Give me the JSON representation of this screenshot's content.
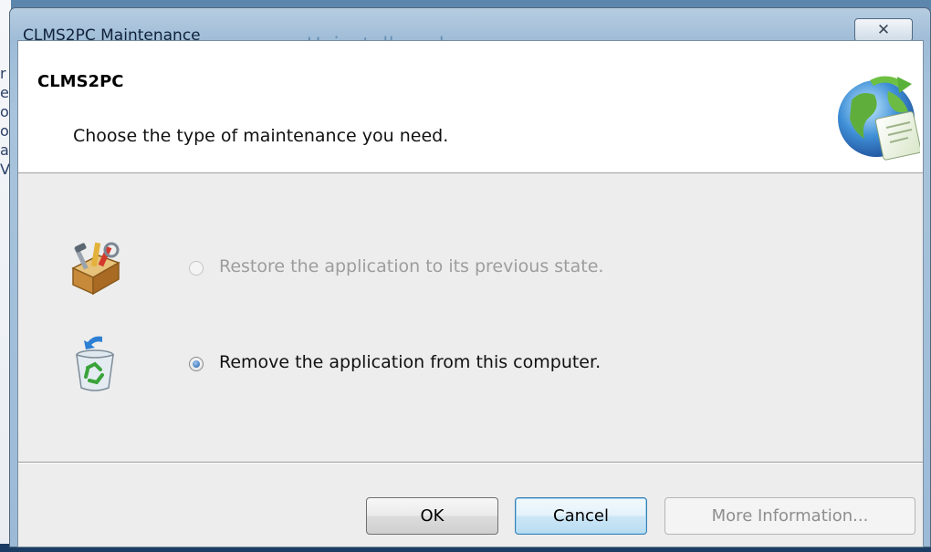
{
  "window": {
    "title": "CLMS2PC Maintenance",
    "background_heading": "Uninstall or change a program",
    "close_glyph": "✕"
  },
  "background": {
    "letters": [
      "r",
      "",
      "e",
      "o",
      "",
      "o",
      "al",
      "",
      "V"
    ]
  },
  "header": {
    "product_name": "CLMS2PC",
    "subtitle": "Choose the type of maintenance you need."
  },
  "options": [
    {
      "label": "Restore the application to its previous state.",
      "icon": "toolbox-icon",
      "selected": false,
      "enabled": false
    },
    {
      "label": "Remove the application from this computer.",
      "icon": "recycle-bin-icon",
      "selected": true,
      "enabled": true
    }
  ],
  "buttons": {
    "ok": "OK",
    "cancel": "Cancel",
    "more_info": "More Information..."
  },
  "colors": {
    "accent": "#3c7fb1",
    "disabled_text": "#9d9d9d"
  }
}
